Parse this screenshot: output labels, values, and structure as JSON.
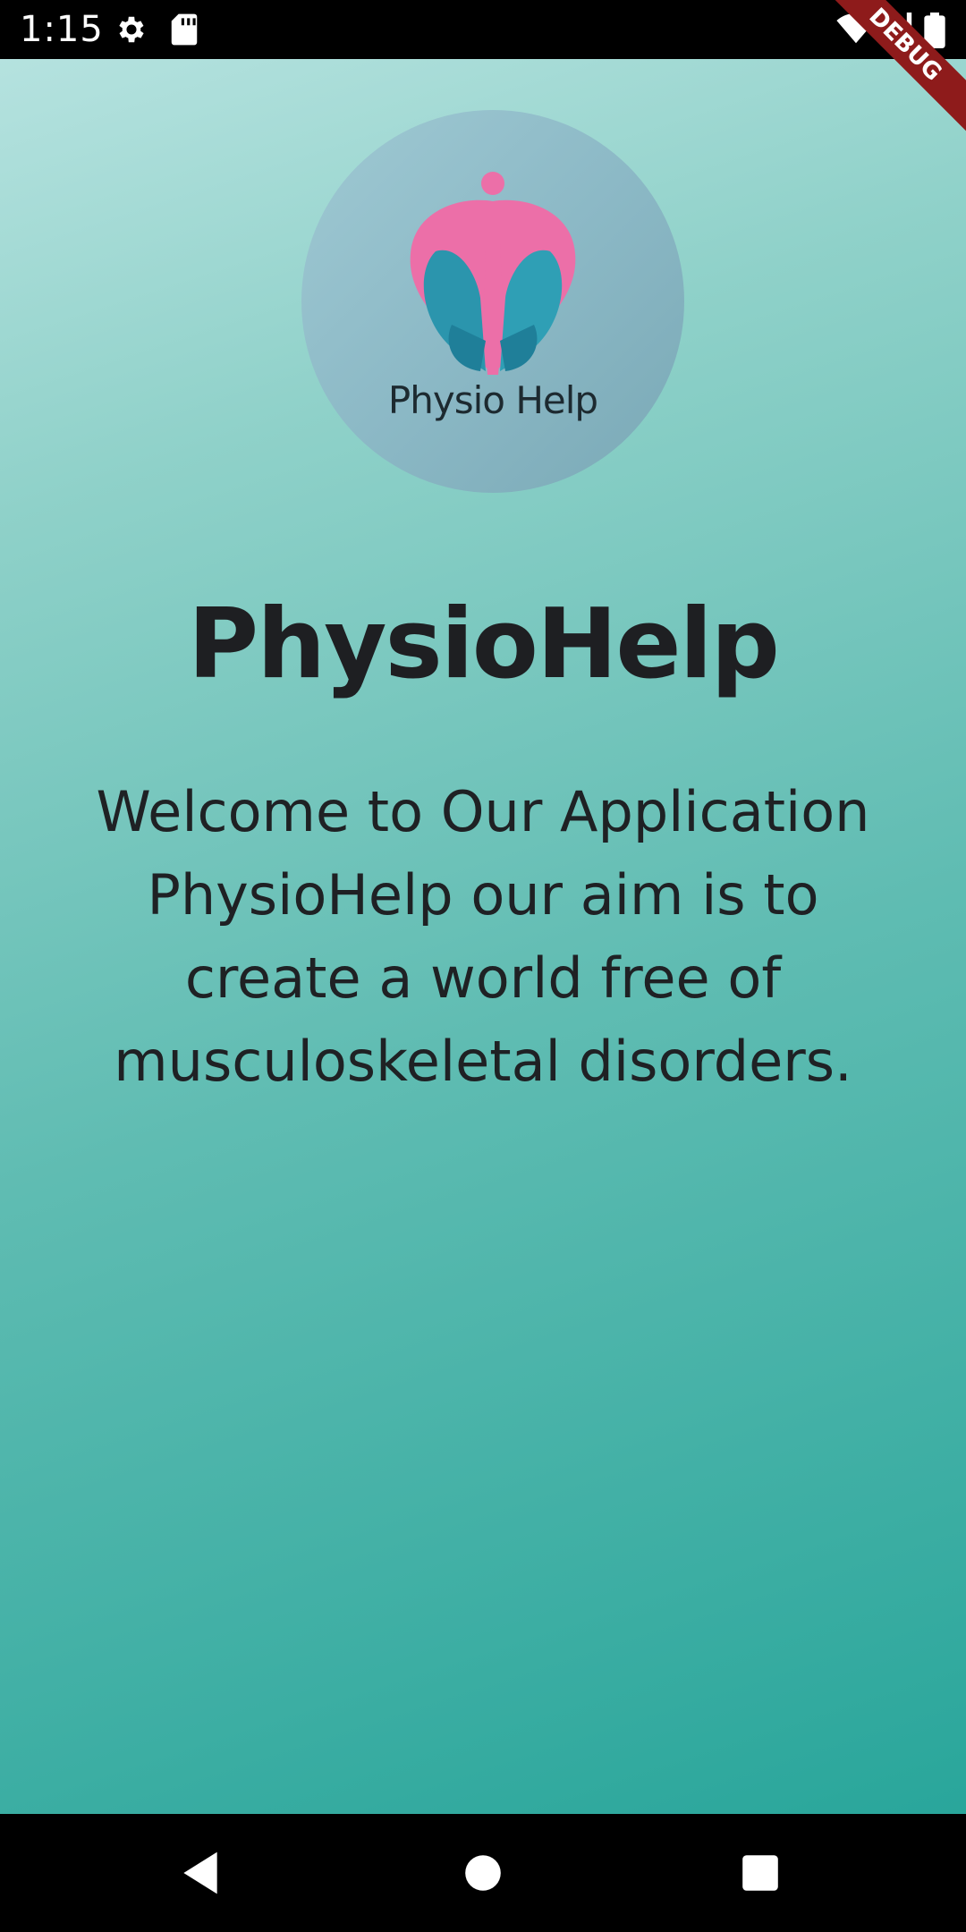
{
  "status_bar": {
    "time": "1:15",
    "icons": [
      "settings-icon",
      "sd-card-icon",
      "wifi-icon",
      "signal-icon",
      "battery-icon"
    ]
  },
  "debug_banner": "DEBUG",
  "logo": {
    "text": "Physio Help",
    "colors": {
      "pink": "#ec6fa8",
      "teal": "#2b95ad",
      "circle": "#8fbcc8"
    }
  },
  "main": {
    "title": "PhysioHelp",
    "welcome": "Welcome to Our Application PhysioHelp our aim is to create a world free of musculoskeletal disorders."
  },
  "nav_bar": {
    "buttons": [
      "back-icon",
      "home-icon",
      "recents-icon"
    ]
  },
  "colors": {
    "gradient_start": "#b5e2df",
    "gradient_end": "#29a69b",
    "text": "#1e1f22"
  }
}
